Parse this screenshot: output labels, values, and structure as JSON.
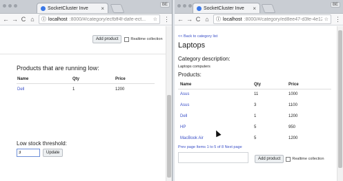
{
  "left_window": {
    "tab_title": "SocketCluster Inve",
    "tab_close": "×",
    "profile_label": "BE",
    "url_host": "localhost",
    "url_path": ":8000/#/category/ecfbff4f-dafe-ect...",
    "add_product_label": "Add product",
    "realtime_label": "Realtime collection",
    "section_title": "Products that are running low:",
    "columns": [
      "Name",
      "Qty",
      "Price"
    ],
    "rows": [
      {
        "name": "Dell",
        "qty": "1",
        "price": "1200"
      }
    ],
    "threshold_label": "Low stock threshold:",
    "threshold_value": "3",
    "update_label": "Update"
  },
  "right_window": {
    "tab_title": "SocketCluster Inve",
    "tab_close": "×",
    "profile_label": "BE",
    "url_host": "localhost",
    "url_path": ":8000/#/category/ed8ee47-d3fe-4e12-8...",
    "back_link": "<< Back to category list",
    "page_title": "Laptops",
    "description_heading": "Category description:",
    "description_text": "Laptops computers",
    "products_heading": "Products:",
    "columns": [
      "Name",
      "Qty",
      "Price"
    ],
    "rows": [
      {
        "name": "Asus",
        "qty": "11",
        "price": "1000"
      },
      {
        "name": "Asus",
        "qty": "3",
        "price": "1100"
      },
      {
        "name": "Dell",
        "qty": "1",
        "price": "1200"
      },
      {
        "name": "HP",
        "qty": "5",
        "price": "950"
      },
      {
        "name": "MacBook Air",
        "qty": "5",
        "price": "1200"
      }
    ],
    "pagination": "Prev page Items 1 to 5 of 8 Next page",
    "add_product_label": "Add product",
    "realtime_label": "Realtime collection"
  }
}
